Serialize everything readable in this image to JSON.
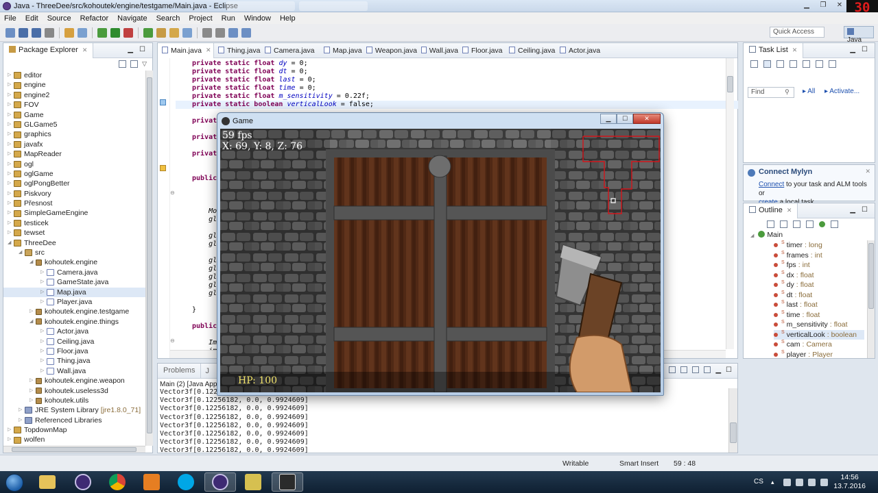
{
  "window": {
    "title": "Java - ThreeDee/src/kohoutek/engine/testgame/Main.java - Eclipse",
    "fps_overlay": "30"
  },
  "menu": [
    "File",
    "Edit",
    "Source",
    "Refactor",
    "Navigate",
    "Search",
    "Project",
    "Run",
    "Window",
    "Help"
  ],
  "toolbar": {
    "quick_access": "Quick Access",
    "perspective": "Java"
  },
  "package_explorer": {
    "tab_label": "Package Explorer",
    "items": [
      {
        "label": "editor",
        "depth": 0,
        "kind": "proj"
      },
      {
        "label": "engine",
        "depth": 0,
        "kind": "proj"
      },
      {
        "label": "engine2",
        "depth": 0,
        "kind": "proj"
      },
      {
        "label": "FOV",
        "depth": 0,
        "kind": "proj"
      },
      {
        "label": "Game",
        "depth": 0,
        "kind": "proj"
      },
      {
        "label": "GLGame5",
        "depth": 0,
        "kind": "proj"
      },
      {
        "label": "graphics",
        "depth": 0,
        "kind": "proj"
      },
      {
        "label": "javafx",
        "depth": 0,
        "kind": "proj"
      },
      {
        "label": "MapReader",
        "depth": 0,
        "kind": "proj"
      },
      {
        "label": "ogl",
        "depth": 0,
        "kind": "proj"
      },
      {
        "label": "oglGame",
        "depth": 0,
        "kind": "proj"
      },
      {
        "label": "oglPongBetter",
        "depth": 0,
        "kind": "proj"
      },
      {
        "label": "Piskvory",
        "depth": 0,
        "kind": "proj"
      },
      {
        "label": "Přesnost",
        "depth": 0,
        "kind": "proj"
      },
      {
        "label": "SimpleGameEngine",
        "depth": 0,
        "kind": "proj"
      },
      {
        "label": "testicek",
        "depth": 0,
        "kind": "proj"
      },
      {
        "label": "tewset",
        "depth": 0,
        "kind": "proj"
      },
      {
        "label": "ThreeDee",
        "depth": 0,
        "kind": "proj",
        "open": true
      },
      {
        "label": "src",
        "depth": 1,
        "kind": "src",
        "open": true
      },
      {
        "label": "kohoutek.engine",
        "depth": 2,
        "kind": "pkg",
        "open": true
      },
      {
        "label": "Camera.java",
        "depth": 3,
        "kind": "java"
      },
      {
        "label": "GameState.java",
        "depth": 3,
        "kind": "java"
      },
      {
        "label": "Map.java",
        "depth": 3,
        "kind": "java",
        "selected": true
      },
      {
        "label": "Player.java",
        "depth": 3,
        "kind": "java"
      },
      {
        "label": "kohoutek.engine.testgame",
        "depth": 2,
        "kind": "pkg"
      },
      {
        "label": "kohoutek.engine.things",
        "depth": 2,
        "kind": "pkg",
        "open": true
      },
      {
        "label": "Actor.java",
        "depth": 3,
        "kind": "java"
      },
      {
        "label": "Ceiling.java",
        "depth": 3,
        "kind": "java"
      },
      {
        "label": "Floor.java",
        "depth": 3,
        "kind": "java"
      },
      {
        "label": "Thing.java",
        "depth": 3,
        "kind": "java"
      },
      {
        "label": "Wall.java",
        "depth": 3,
        "kind": "java"
      },
      {
        "label": "kohoutek.engine.weapon",
        "depth": 2,
        "kind": "pkg"
      },
      {
        "label": "kohoutek.useless3d",
        "depth": 2,
        "kind": "pkg"
      },
      {
        "label": "kohoutek.utils",
        "depth": 2,
        "kind": "pkg"
      },
      {
        "label": "JRE System Library",
        "suffix": "[jre1.8.0_71]",
        "depth": 1,
        "kind": "lib"
      },
      {
        "label": "Referenced Libraries",
        "depth": 1,
        "kind": "lib"
      },
      {
        "label": "TopdownMap",
        "depth": 0,
        "kind": "proj"
      },
      {
        "label": "wolfen",
        "depth": 0,
        "kind": "proj"
      }
    ]
  },
  "editor": {
    "tabs": [
      "Main.java",
      "Thing.java",
      "Camera.java",
      "Map.java",
      "Weapon.java",
      "Wall.java",
      "Floor.java",
      "Ceiling.java",
      "Actor.java"
    ],
    "code": [
      {
        "kw": "private static float",
        "name": "dy",
        "rest": " = 0;"
      },
      {
        "kw": "private static float",
        "name": "dt",
        "rest": " = 0;"
      },
      {
        "kw": "private static float",
        "name": "last",
        "rest": " = 0;"
      },
      {
        "kw": "private static float",
        "name": "time",
        "rest": " = 0;"
      },
      {
        "kw": "private static float",
        "name": "m_sensitivity",
        "rest": " = 0.22f;"
      },
      {
        "kw": "private static boolean",
        "name": "verticalLook",
        "rest": " = false;"
      },
      {
        "kw": "",
        "name": "",
        "rest": ""
      },
      {
        "kw": "private",
        "name": "",
        "rest": ""
      },
      {
        "kw": "",
        "name": "",
        "rest": ""
      },
      {
        "kw": "private",
        "name": "",
        "rest": ""
      },
      {
        "kw": "",
        "name": "",
        "rest": ""
      },
      {
        "kw": "private",
        "name": "",
        "rest": ""
      },
      {
        "kw": "",
        "name": "",
        "rest": ""
      },
      {
        "kw": "",
        "name": "",
        "rest": ""
      },
      {
        "kw": "public",
        "name": "",
        "rest": ""
      },
      {
        "kw": "",
        "name": "",
        "rest": ""
      },
      {
        "kw": "",
        "name": "",
        "rest": ""
      },
      {
        "kw": "",
        "name": "",
        "rest": ""
      },
      {
        "kw": "",
        "name": "",
        "rest": "    Mou"
      },
      {
        "kw": "",
        "name": "",
        "rest": "    gl"
      },
      {
        "kw": "",
        "name": "",
        "rest": ""
      },
      {
        "kw": "",
        "name": "",
        "rest": "    gl"
      },
      {
        "kw": "",
        "name": "",
        "rest": "    gl"
      },
      {
        "kw": "",
        "name": "",
        "rest": ""
      },
      {
        "kw": "",
        "name": "",
        "rest": "    gl"
      },
      {
        "kw": "",
        "name": "",
        "rest": "    gl"
      },
      {
        "kw": "",
        "name": "",
        "rest": "    gl"
      },
      {
        "kw": "",
        "name": "",
        "rest": "    gl"
      },
      {
        "kw": "",
        "name": "",
        "rest": "    gl"
      },
      {
        "kw": "",
        "name": "",
        "rest": ""
      },
      {
        "kw": "",
        "name": "",
        "rest": "}"
      },
      {
        "kw": "",
        "name": "",
        "rest": ""
      },
      {
        "kw": "public",
        "name": "",
        "rest": ""
      },
      {
        "kw": "",
        "name": "",
        "rest": ""
      },
      {
        "kw": "",
        "name": "",
        "rest": "    Ima"
      },
      {
        "kw": "",
        "name": "",
        "rest": "    im"
      }
    ]
  },
  "console": {
    "tab_label": "Problems",
    "tab2_label": "J",
    "header": "Main (2) [Java Appli",
    "lines": [
      "Vector3f[0.12256",
      "Vector3f[0.12256182, 0.0, 0.9924609]",
      "Vector3f[0.12256182, 0.0, 0.9924609]",
      "Vector3f[0.12256182, 0.0, 0.9924609]",
      "Vector3f[0.12256182, 0.0, 0.9924609]",
      "Vector3f[0.12256182, 0.0, 0.9924609]",
      "Vector3f[0.12256182, 0.0, 0.9924609]",
      "Vector3f[0.12256182, 0.0, 0.9924609]"
    ]
  },
  "tasklist": {
    "tab_label": "Task List",
    "find_placeholder": "Find",
    "all_label": "All",
    "activate_label": "Activate..."
  },
  "mylyn": {
    "title": "Connect Mylyn",
    "connect_link": "Connect",
    "text1": " to your task and ALM tools or",
    "create_link": "create",
    "text2": " a local task."
  },
  "outline": {
    "tab_label": "Outline",
    "root": "Main",
    "members": [
      {
        "name": "timer",
        "type": "long"
      },
      {
        "name": "frames",
        "type": "int"
      },
      {
        "name": "fps",
        "type": "int"
      },
      {
        "name": "dx",
        "type": "float"
      },
      {
        "name": "dy",
        "type": "float"
      },
      {
        "name": "dt",
        "type": "float"
      },
      {
        "name": "last",
        "type": "float"
      },
      {
        "name": "time",
        "type": "float"
      },
      {
        "name": "m_sensitivity",
        "type": "float"
      },
      {
        "name": "verticalLook",
        "type": "boolean",
        "selected": true
      },
      {
        "name": "cam",
        "type": "Camera"
      },
      {
        "name": "player",
        "type": "Player"
      }
    ]
  },
  "status": {
    "writable": "Writable",
    "insert_mode": "Smart Insert",
    "position": "59 : 48"
  },
  "game": {
    "title": "Game",
    "fps": "59 fps",
    "position": "X: 69, Y: 8, Z: 76",
    "hp": "HP: 100"
  },
  "taskbar": {
    "lang": "CS",
    "time": "14:56",
    "date": "13.7.2016"
  },
  "colors": {
    "keyword": "#7f0055",
    "field": "#0000c0",
    "link": "#1c4fae",
    "hud_hp": "#f1e36b",
    "minimap": "#d4141a"
  }
}
